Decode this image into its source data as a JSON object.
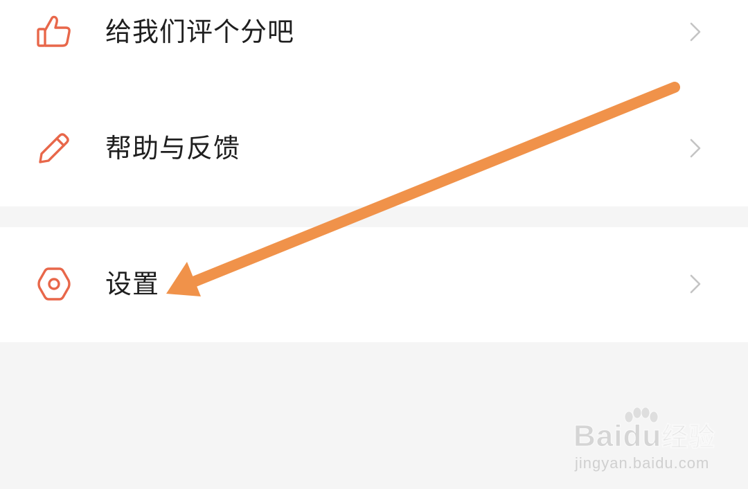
{
  "menu": {
    "items": [
      {
        "key": "rate",
        "label": "给我们评个分吧",
        "icon": "thumbs-up-icon"
      },
      {
        "key": "help",
        "label": "帮助与反馈",
        "icon": "pencil-icon"
      },
      {
        "key": "settings",
        "label": "设置",
        "icon": "gear-icon"
      }
    ],
    "chevron_icon": "chevron-right-icon"
  },
  "annotation": {
    "type": "arrow",
    "target": "settings",
    "color": "#f0924a"
  },
  "watermark": {
    "logo_text": "Bai",
    "logo_text_2": "du",
    "logo_text_3": "经验",
    "url": "jingyan.baidu.com"
  },
  "colors": {
    "icon": "#e8674a",
    "text": "#1f1f1f",
    "chevron": "#c4c4c4",
    "background": "#f5f5f5",
    "card": "#ffffff"
  }
}
